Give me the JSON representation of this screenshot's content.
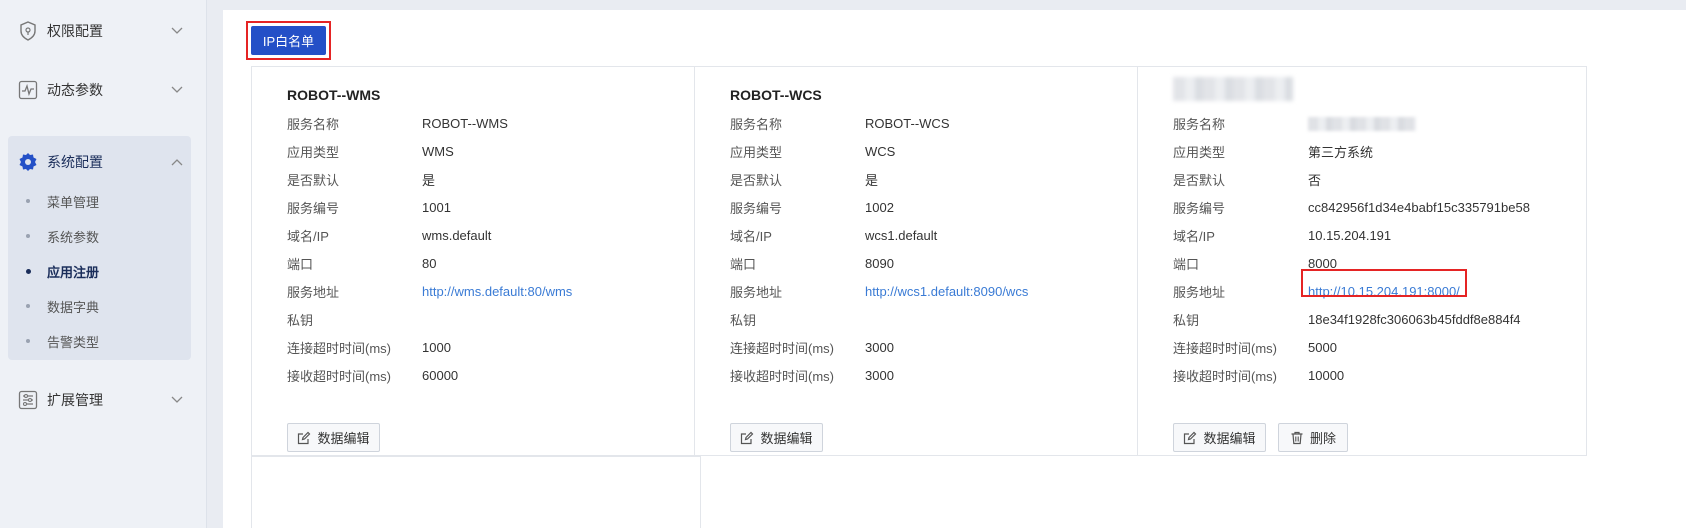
{
  "sidebar": {
    "groups": [
      {
        "label": "权限配置",
        "icon": "shield-icon"
      },
      {
        "label": "动态参数",
        "icon": "pulse-icon"
      },
      {
        "label": "系统配置",
        "icon": "gear-icon"
      },
      {
        "label": "扩展管理",
        "icon": "sliders-icon"
      }
    ],
    "sub_items": [
      "菜单管理",
      "系统参数",
      "应用注册",
      "数据字典",
      "告警类型"
    ],
    "active_sub_item": "应用注册"
  },
  "toolbar": {
    "ip_whitelist_label": "IP白名单"
  },
  "field_labels": {
    "service_name": "服务名称",
    "app_type": "应用类型",
    "is_default": "是否默认",
    "service_code": "服务编号",
    "domain_ip": "域名/IP",
    "port": "端口",
    "service_url": "服务地址",
    "private_key": "私钥",
    "connect_timeout": "连接超时时间(ms)",
    "receive_timeout": "接收超时时间(ms)"
  },
  "buttons": {
    "edit_label": "数据编辑",
    "delete_label": "删除"
  },
  "cards": [
    {
      "title": "ROBOT--WMS",
      "service_name": "ROBOT--WMS",
      "app_type": "WMS",
      "is_default": "是",
      "service_code": "1001",
      "domain_ip": "wms.default",
      "port": "80",
      "service_url": "http://wms.default:80/wms",
      "private_key": "",
      "connect_timeout": "1000",
      "receive_timeout": "60000"
    },
    {
      "title": "ROBOT--WCS",
      "service_name": "ROBOT--WCS",
      "app_type": "WCS",
      "is_default": "是",
      "service_code": "1002",
      "domain_ip": "wcs1.default",
      "port": "8090",
      "service_url": "http://wcs1.default:8090/wcs",
      "private_key": "",
      "connect_timeout": "3000",
      "receive_timeout": "3000"
    },
    {
      "title": "",
      "service_name": "",
      "app_type": "第三方系统",
      "is_default": "否",
      "service_code": "cc842956f1d34e4babf15c335791be58",
      "domain_ip": "10.15.204.191",
      "port": "8000",
      "service_url": "http://10.15.204.191:8000/",
      "private_key": "18e34f1928fc306063b45fddf8e884f4",
      "connect_timeout": "5000",
      "receive_timeout": "10000"
    }
  ],
  "colors": {
    "primary_button": "#2450c7",
    "link": "#3a7bd5",
    "highlight_box": "#e52424"
  }
}
